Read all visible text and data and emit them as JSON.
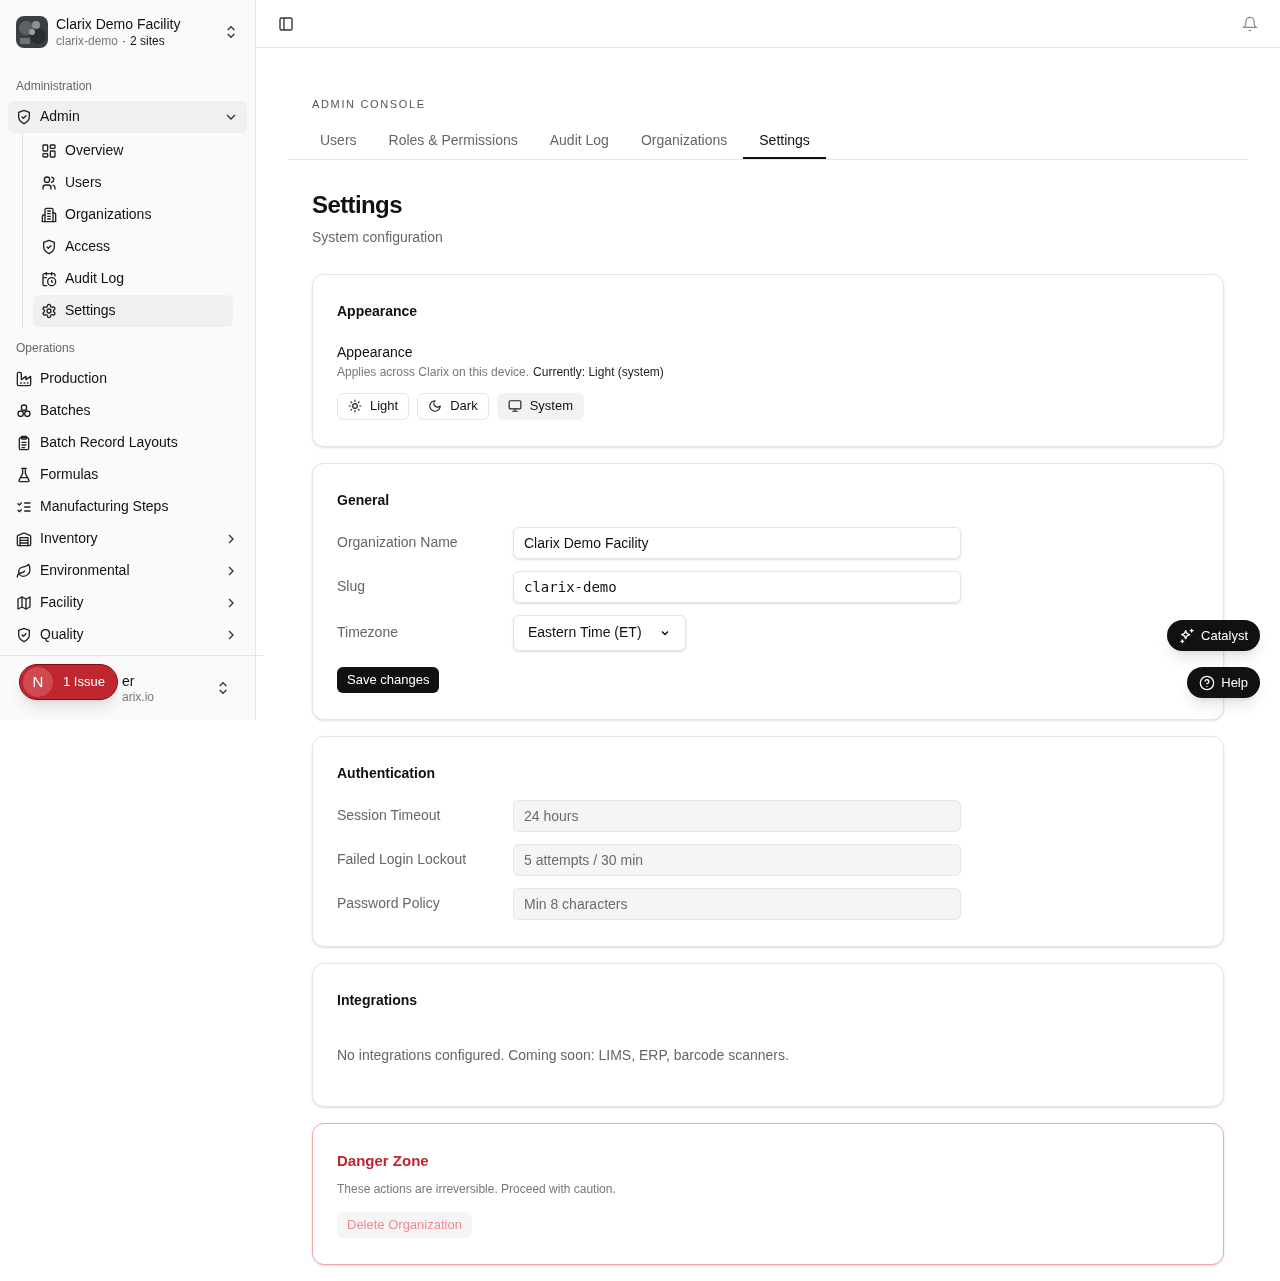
{
  "org": {
    "name": "Clarix Demo Facility",
    "slug": "clarix-demo",
    "separator": "·",
    "sites": "2 sites"
  },
  "sidebar": {
    "groups": [
      {
        "label": "Administration",
        "items": [
          {
            "label": "Admin",
            "kind": "parent",
            "expanded": true,
            "children": [
              {
                "label": "Overview",
                "selected": false
              },
              {
                "label": "Users",
                "selected": false
              },
              {
                "label": "Organizations",
                "selected": false
              },
              {
                "label": "Access",
                "selected": false
              },
              {
                "label": "Audit Log",
                "selected": false
              },
              {
                "label": "Settings",
                "selected": true
              }
            ]
          }
        ]
      },
      {
        "label": "Operations",
        "items": [
          {
            "label": "Production",
            "kind": "link"
          },
          {
            "label": "Batches",
            "kind": "link"
          },
          {
            "label": "Batch Record Layouts",
            "kind": "link"
          },
          {
            "label": "Formulas",
            "kind": "link"
          },
          {
            "label": "Manufacturing Steps",
            "kind": "link"
          },
          {
            "label": "Inventory",
            "kind": "parent",
            "expanded": false
          },
          {
            "label": "Environmental",
            "kind": "parent",
            "expanded": false
          },
          {
            "label": "Facility",
            "kind": "parent",
            "expanded": false
          },
          {
            "label": "Quality",
            "kind": "parent",
            "expanded": false
          }
        ]
      }
    ]
  },
  "user": {
    "name": "er",
    "email": "arix.io"
  },
  "issue_badge": {
    "letter": "N",
    "label": "1 Issue"
  },
  "eyebrow": "ADMIN CONSOLE",
  "tabs": [
    {
      "label": "Users",
      "selected": false
    },
    {
      "label": "Roles & Permissions",
      "selected": false
    },
    {
      "label": "Audit Log",
      "selected": false
    },
    {
      "label": "Organizations",
      "selected": false
    },
    {
      "label": "Settings",
      "selected": true
    }
  ],
  "page": {
    "title": "Settings",
    "subtitle": "System configuration"
  },
  "appearance": {
    "title": "Appearance",
    "label": "Appearance",
    "hint": "Applies across Clarix on this device.",
    "current": "Currently: Light (system)",
    "options": [
      {
        "label": "Light",
        "selected": false
      },
      {
        "label": "Dark",
        "selected": false
      },
      {
        "label": "System",
        "selected": true
      }
    ]
  },
  "general": {
    "title": "General",
    "fields": [
      {
        "label": "Organization Name",
        "kind": "text",
        "value": "Clarix Demo Facility"
      },
      {
        "label": "Slug",
        "kind": "mono",
        "value": "clarix-demo"
      },
      {
        "label": "Timezone",
        "kind": "select",
        "value": "Eastern Time (ET)"
      }
    ],
    "save": "Save changes"
  },
  "authentication": {
    "title": "Authentication",
    "fields": [
      {
        "label": "Session Timeout",
        "value": "24 hours",
        "disabled": true
      },
      {
        "label": "Failed Login Lockout",
        "value": "5 attempts / 30 min",
        "disabled": true
      },
      {
        "label": "Password Policy",
        "value": "Min 8 characters",
        "disabled": true
      }
    ]
  },
  "integrations": {
    "title": "Integrations",
    "text": "No integrations configured. Coming soon: LIMS, ERP, barcode scanners."
  },
  "danger": {
    "title": "Danger Zone",
    "text": "These actions are irreversible. Proceed with caution.",
    "button": "Delete Organization",
    "button_disabled": true
  },
  "floating": [
    {
      "label": "Catalyst",
      "kind": "assistant"
    },
    {
      "label": "Help",
      "kind": "help"
    }
  ]
}
